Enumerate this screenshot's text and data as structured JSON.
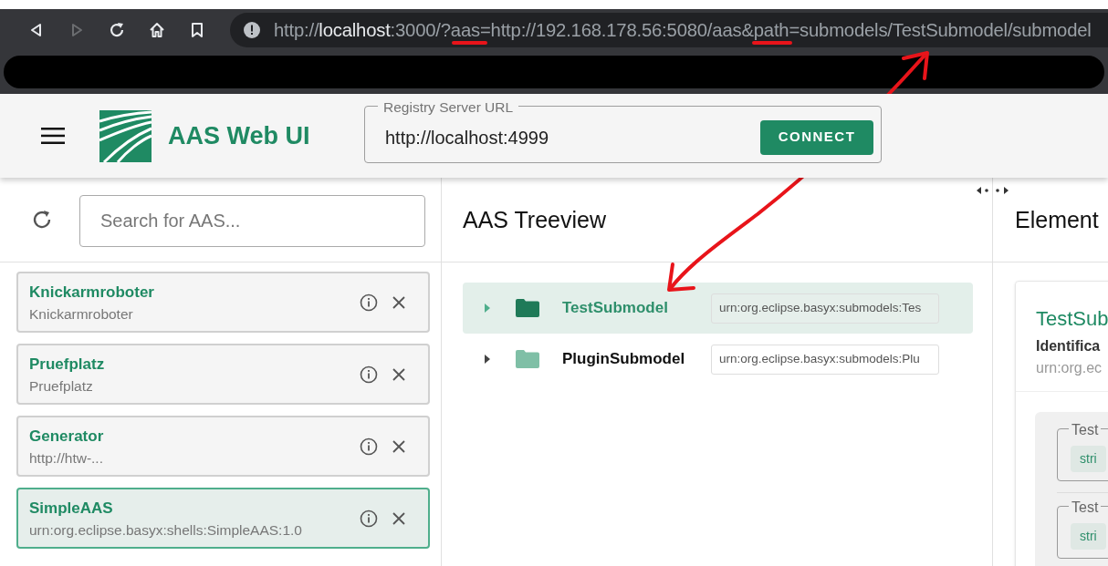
{
  "browser": {
    "nav_buttons": [
      {
        "kind": "back",
        "disabled": false
      },
      {
        "kind": "forward",
        "disabled": true
      },
      {
        "kind": "reload",
        "disabled": false
      },
      {
        "kind": "home",
        "disabled": false
      },
      {
        "kind": "bookmark",
        "disabled": false
      }
    ],
    "url_parts": [
      {
        "text": "http://",
        "emphasized": false
      },
      {
        "text": "localhost",
        "emphasized": true
      },
      {
        "text": ":3000/?aas=http://192.168.178.56:5080/aas&path=submodels/TestSubmodel/submodel",
        "emphasized": false
      }
    ]
  },
  "app": {
    "title": "AAS Web UI",
    "registry": {
      "label": "Registry Server URL",
      "value": "http://localhost:4999"
    },
    "connect_button": "CONNECT"
  },
  "aas_list": {
    "search": {
      "placeholder": "Search for AAS..."
    },
    "items": [
      {
        "name": "Knickarmroboter",
        "id": "Knickarmroboter",
        "selected": false
      },
      {
        "name": "Pruefplatz",
        "id": "Pruefplatz",
        "selected": false
      },
      {
        "name": "Generator",
        "id": "http://htw-...",
        "selected": false
      },
      {
        "name": "SimpleAAS",
        "id": "urn:org.eclipse.basyx:shells:SimpleAAS:1.0",
        "selected": true
      }
    ]
  },
  "treeview": {
    "title": "AAS Treeview",
    "items": [
      {
        "name": "TestSubmodel",
        "id": "urn:org.eclipse.basyx:submodels:Tes",
        "selected": true
      },
      {
        "name": "PluginSubmodel",
        "id": "urn:org.eclipse.basyx:submodels:Plu",
        "selected": false
      }
    ]
  },
  "element": {
    "title": "Element",
    "card": {
      "name": "TestSub",
      "label": "Identifica",
      "value": "urn:org.ec"
    },
    "properties": [
      {
        "label": "Test",
        "value": "stri"
      },
      {
        "label": "Test",
        "value": "stri"
      }
    ]
  }
}
